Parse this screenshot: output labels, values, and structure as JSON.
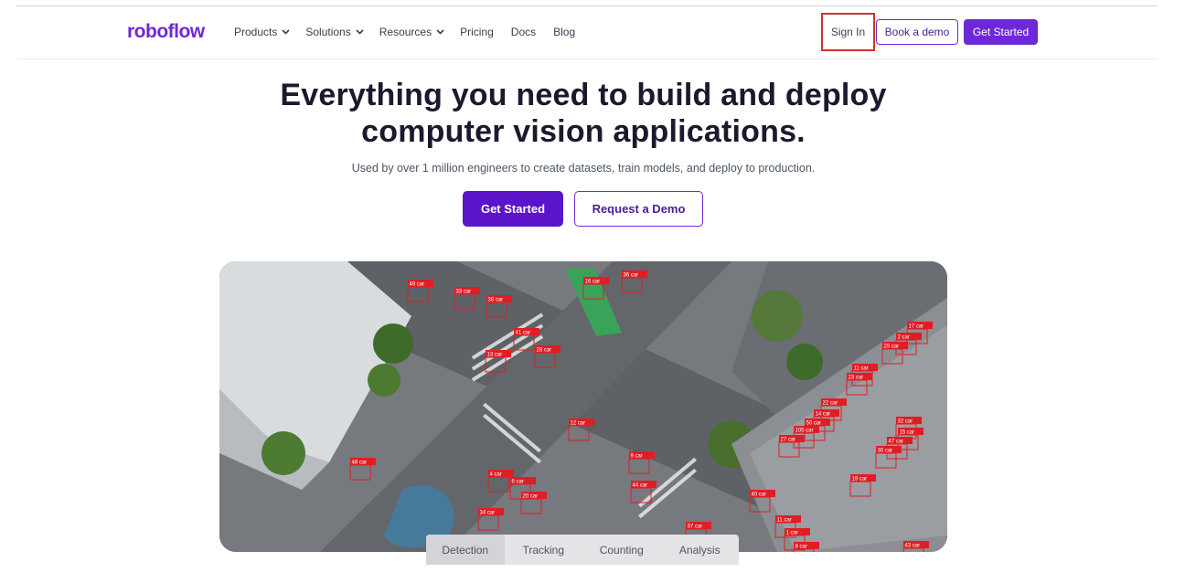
{
  "header": {
    "logo": "roboflow",
    "menu": [
      {
        "label": "Products",
        "has_dropdown": true
      },
      {
        "label": "Solutions",
        "has_dropdown": true
      },
      {
        "label": "Resources",
        "has_dropdown": true
      },
      {
        "label": "Pricing",
        "has_dropdown": false
      },
      {
        "label": "Docs",
        "has_dropdown": false
      },
      {
        "label": "Blog",
        "has_dropdown": false
      }
    ],
    "sign_in": "Sign In",
    "book_demo": "Book a demo",
    "get_started": "Get Started"
  },
  "hero": {
    "title_line1": "Everything you need to build and deploy",
    "title_line2": "computer vision applications.",
    "subtitle": "Used by over 1 million engineers to create datasets, train models, and deploy to production.",
    "primary_cta": "Get Started",
    "secondary_cta": "Request a Demo"
  },
  "video": {
    "detections": [
      {
        "label": "49 car"
      },
      {
        "label": "33 car"
      },
      {
        "label": "38 car"
      },
      {
        "label": "16 car"
      },
      {
        "label": "36 car"
      },
      {
        "label": "41 car"
      },
      {
        "label": "13 car"
      },
      {
        "label": "28 car"
      },
      {
        "label": "12 car"
      },
      {
        "label": "9 car"
      },
      {
        "label": "44 car"
      },
      {
        "label": "48 car"
      },
      {
        "label": "4 car"
      },
      {
        "label": "6 car"
      },
      {
        "label": "20 car"
      },
      {
        "label": "34 car"
      },
      {
        "label": "37 car"
      },
      {
        "label": "40 car"
      },
      {
        "label": "11 car"
      },
      {
        "label": "1 car"
      },
      {
        "label": "8 car"
      },
      {
        "label": "17 car"
      },
      {
        "label": "2 car"
      },
      {
        "label": "29 car"
      },
      {
        "label": "11 car"
      },
      {
        "label": "23 car"
      },
      {
        "label": "22 car"
      },
      {
        "label": "14 car"
      },
      {
        "label": "50 car"
      },
      {
        "label": "105 car"
      },
      {
        "label": "27 car"
      },
      {
        "label": "32 car"
      },
      {
        "label": "15 car"
      },
      {
        "label": "47 car"
      },
      {
        "label": "30 car"
      },
      {
        "label": "19 car"
      },
      {
        "label": "43 car"
      }
    ],
    "tabs": [
      "Detection",
      "Tracking",
      "Counting",
      "Analysis"
    ],
    "active_tab": "Detection"
  },
  "colors": {
    "brand": "#6d28d9",
    "cta": "#5b14c9",
    "highlight_border": "#d0312d",
    "detection_box": "#e11d24"
  }
}
